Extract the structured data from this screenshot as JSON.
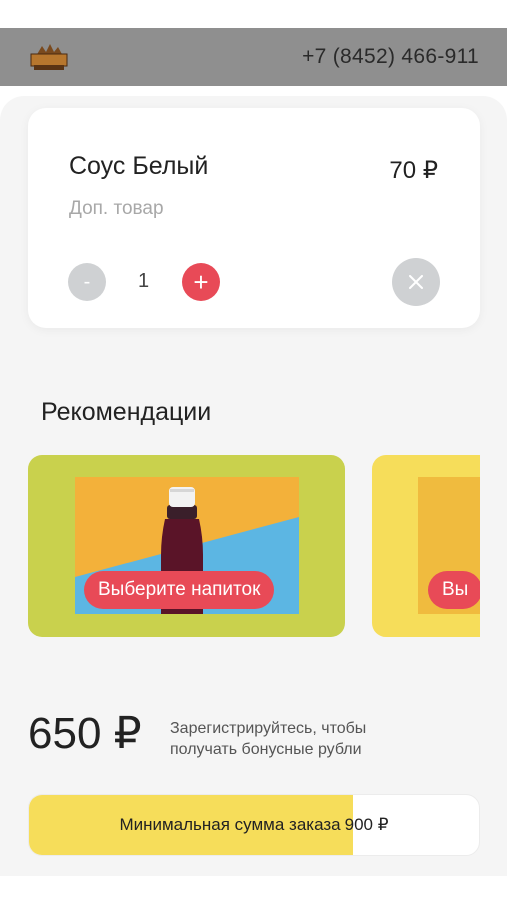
{
  "header": {
    "logo_text": "MEAT",
    "phone": "+7 (8452) 466-911"
  },
  "cart": {
    "item": {
      "name": "Соус Белый",
      "subtitle": "Доп. товар",
      "price": "70 ₽",
      "quantity": "1"
    },
    "minus_label": "-",
    "plus_label": "+"
  },
  "recommendations": {
    "title": "Рекомендации",
    "cards": [
      {
        "button_label": "Выберите напиток",
        "color": "#c9d14d"
      },
      {
        "button_label": "Вы",
        "color": "#f6dd5a"
      }
    ]
  },
  "total": {
    "amount": "650 ₽",
    "bonus_note": "Зарегистрируйтесь, чтобы получать бонусные рубли"
  },
  "min_order": {
    "label": "Минимальная сумма заказа",
    "amount": "900 ₽",
    "progress_fraction": 0.72
  },
  "colors": {
    "accent": "#e84a57",
    "header_bg": "#8f8f8f",
    "yellow": "#f6dd5a",
    "olive": "#c9d14d"
  }
}
